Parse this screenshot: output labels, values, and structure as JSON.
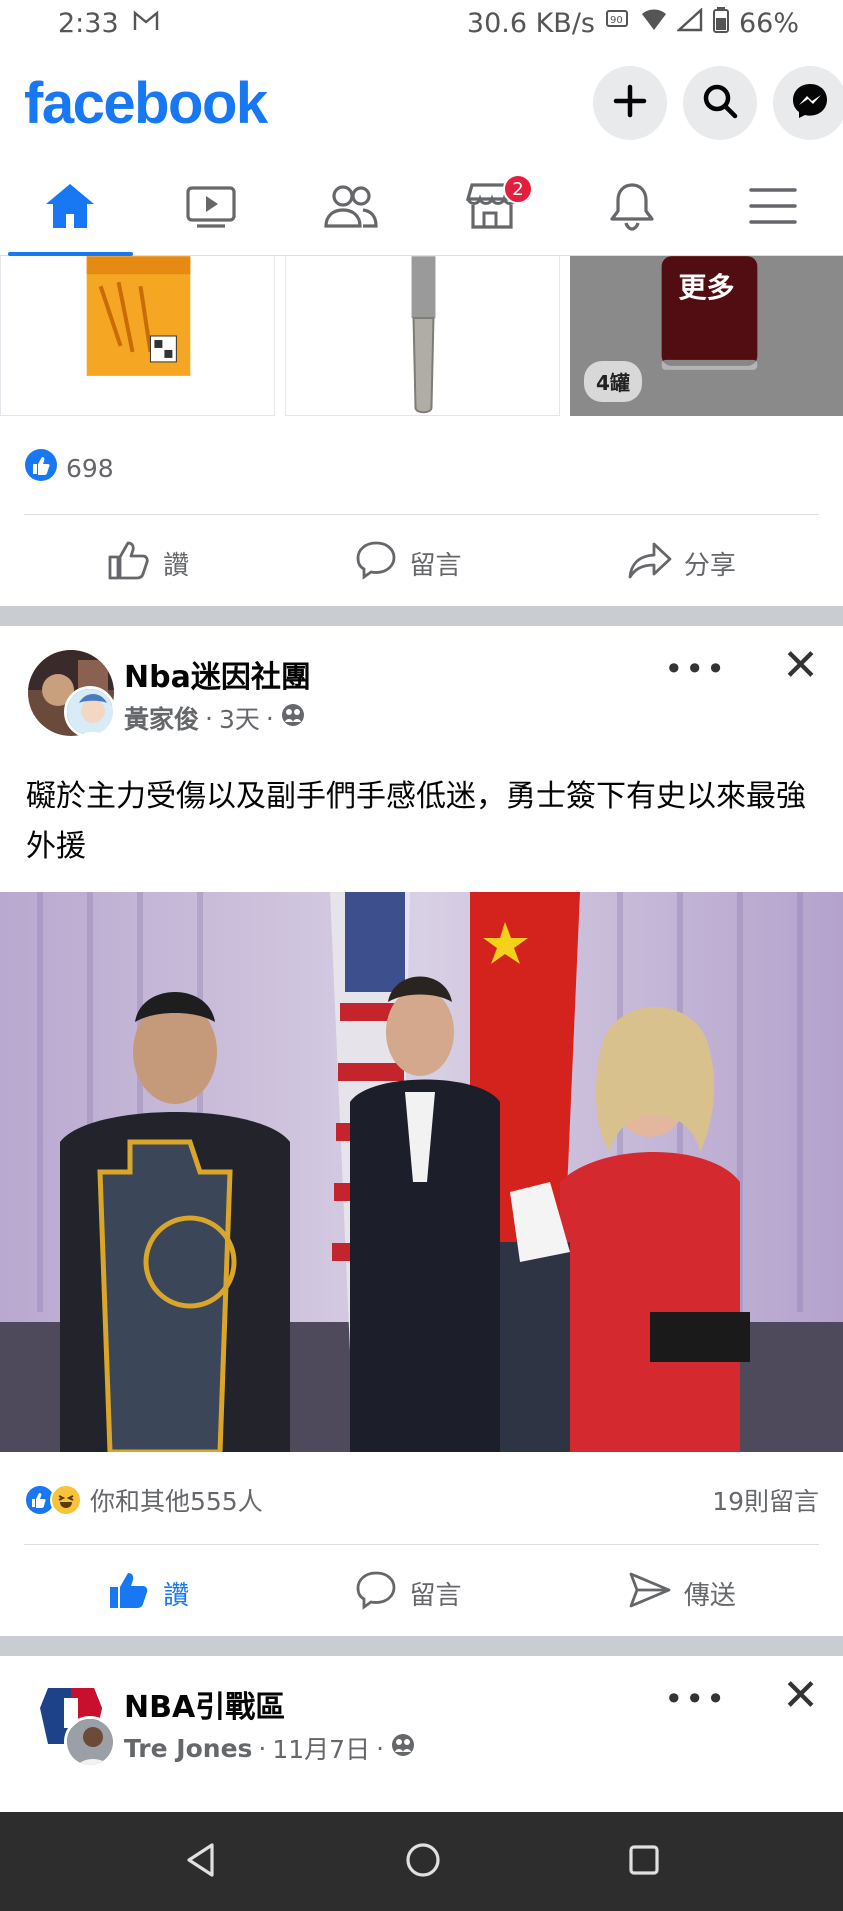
{
  "status_bar": {
    "time": "2:33",
    "net_speed": "30.6 KB/s",
    "battery": "66%"
  },
  "header": {
    "logo": "facebook",
    "buttons": [
      "plus-icon",
      "search-icon",
      "messenger-icon"
    ]
  },
  "tabs": [
    {
      "name": "home",
      "icon": "home-icon",
      "active": true
    },
    {
      "name": "watch",
      "icon": "video-icon"
    },
    {
      "name": "friends",
      "icon": "friends-icon"
    },
    {
      "name": "marketplace",
      "icon": "marketplace-icon",
      "badge": "2"
    },
    {
      "name": "notifications",
      "icon": "bell-icon"
    },
    {
      "name": "menu",
      "icon": "menu-icon"
    }
  ],
  "product_strip": {
    "more_label": "更多",
    "count_chip": "4罐"
  },
  "post1": {
    "reaction_count": "698",
    "actions": {
      "like": "讚",
      "comment": "留言",
      "share": "分享"
    }
  },
  "post2": {
    "group": "Nba迷因社團",
    "author": "黃家俊",
    "time": "3天",
    "text": "礙於主力受傷以及副手們手感低迷，勇士簽下有史以來最強外援",
    "reactions": "你和其他555人",
    "comments": "19則留言",
    "actions": {
      "like": "讚",
      "comment": "留言",
      "send": "傳送"
    }
  },
  "post3": {
    "group": "NBA引戰區",
    "author": "Tre Jones",
    "time": "11月7日"
  },
  "colors": {
    "brand": "#1877f2",
    "badge": "#e41e3f",
    "secondary_text": "#65676b"
  }
}
